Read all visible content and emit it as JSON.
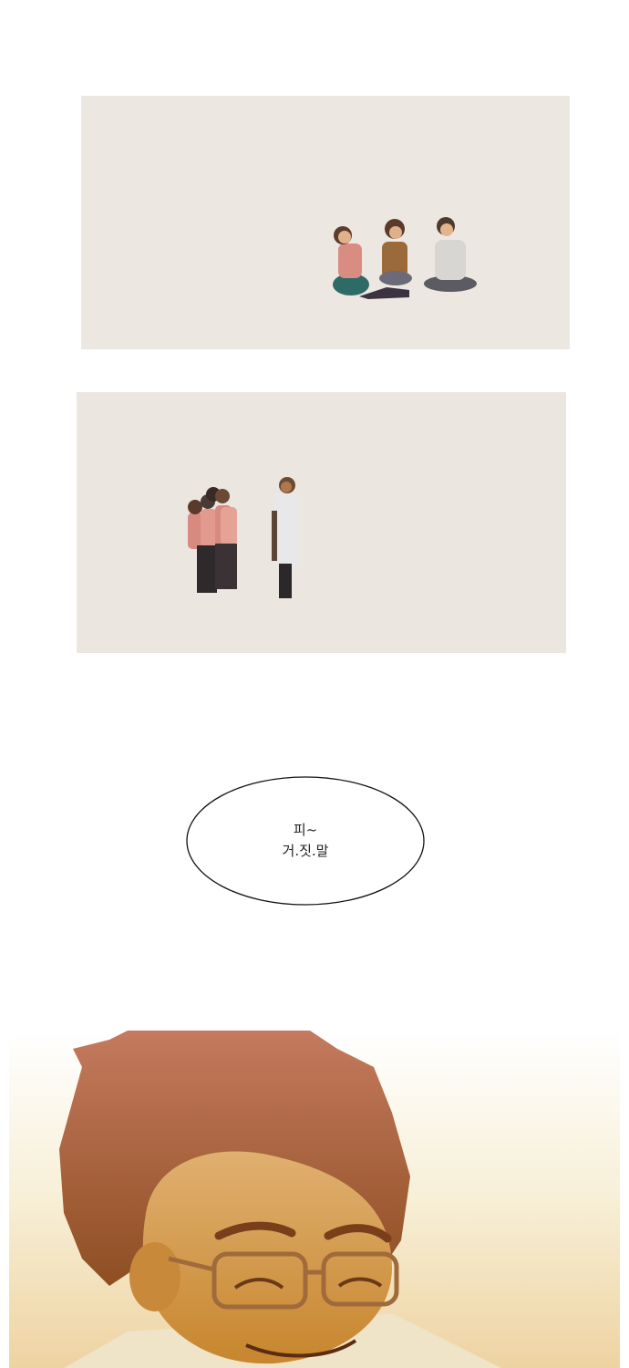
{
  "speech_bubble": {
    "line_1": "피~",
    "line_2": "거.짓.말"
  },
  "colors": {
    "panel_background": "#ece7e1",
    "page_background": "#ffffff",
    "hair": "#a8563a",
    "skin": "#d9a35a",
    "gradient_top": "#ffffff",
    "gradient_bottom": "#e8b85a"
  }
}
